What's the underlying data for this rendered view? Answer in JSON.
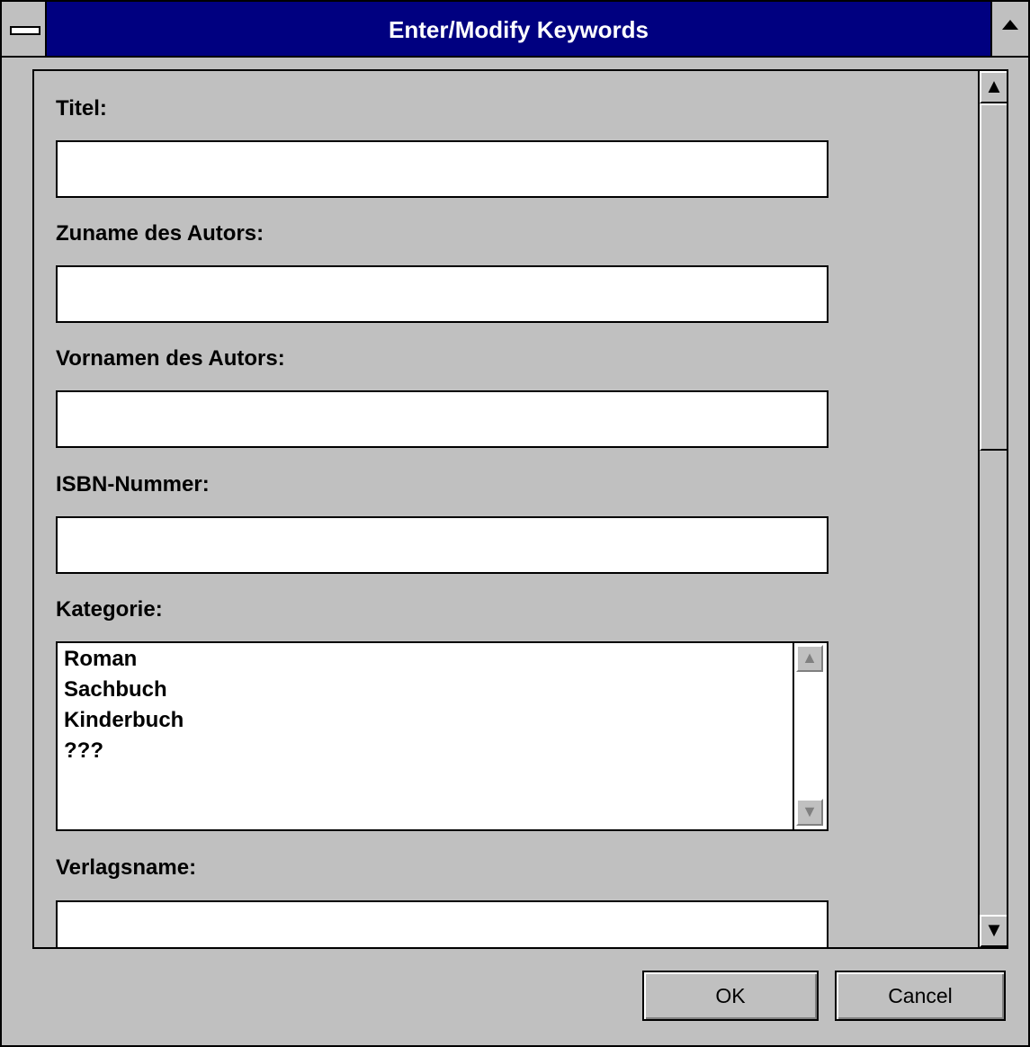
{
  "window": {
    "title": "Enter/Modify Keywords"
  },
  "fields": {
    "titel": {
      "label": "Titel:",
      "value": ""
    },
    "zuname": {
      "label": "Zuname des Autors:",
      "value": ""
    },
    "vorname": {
      "label": "Vornamen des Autors:",
      "value": ""
    },
    "isbn": {
      "label": "ISBN-Nummer:",
      "value": ""
    },
    "kategorie": {
      "label": "Kategorie:",
      "options": [
        "Roman",
        "Sachbuch",
        "Kinderbuch",
        "???"
      ]
    },
    "verlag": {
      "label": "Verlagsname:",
      "value": ""
    }
  },
  "buttons": {
    "ok": "OK",
    "cancel": "Cancel"
  },
  "icons": {
    "system_menu": "system-menu-icon",
    "maximize": "maximize-icon",
    "scroll_up": "scroll-up-arrow-icon",
    "scroll_down": "scroll-down-arrow-icon"
  }
}
